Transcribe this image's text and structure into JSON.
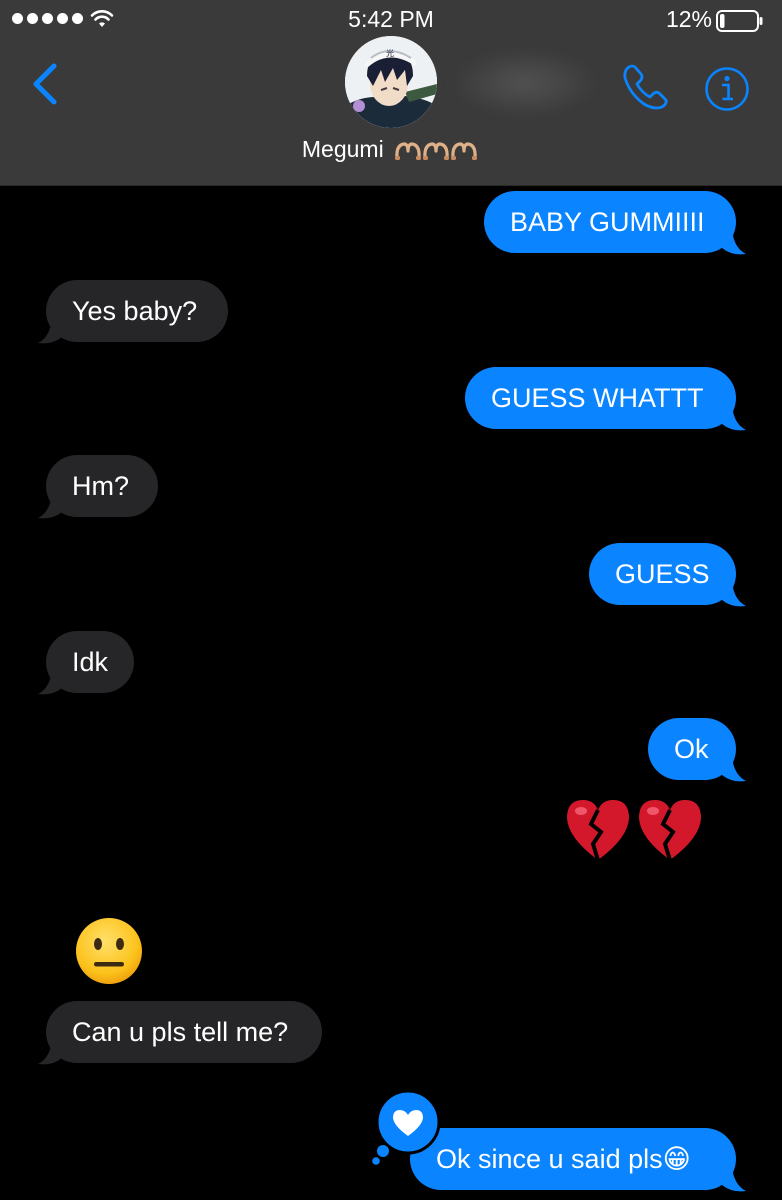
{
  "status_bar": {
    "time": "5:42 PM",
    "battery_percent": "12%",
    "signal_bars": 5,
    "battery_level": 0.12
  },
  "header": {
    "contact_name": "Megumi",
    "contact_emoji": "🫶🫶🫶",
    "icons": {
      "back": "back-chevron-icon",
      "call": "phone-icon",
      "info": "info-icon"
    }
  },
  "messages": [
    {
      "direction": "out",
      "text": "BABY GUMMIIII"
    },
    {
      "direction": "in",
      "text": "Yes baby?"
    },
    {
      "direction": "out",
      "text": "GUESS WHATTT"
    },
    {
      "direction": "in",
      "text": "Hm?"
    },
    {
      "direction": "out",
      "text": "GUESS"
    },
    {
      "direction": "in",
      "text": "Idk"
    },
    {
      "direction": "out",
      "text": "Ok"
    },
    {
      "direction": "out",
      "emoji": "💔💔"
    },
    {
      "direction": "in",
      "emoji": "😐"
    },
    {
      "direction": "in",
      "text": "Can u pls tell me?"
    },
    {
      "direction": "out",
      "text": "Ok since u said pls😁",
      "tapback": "heart"
    }
  ],
  "colors": {
    "header_bg": "#3a3a3a",
    "outgoing_bubble": "#0a84ff",
    "incoming_bubble": "#262628",
    "accent": "#0a84ff",
    "background": "#000000"
  }
}
